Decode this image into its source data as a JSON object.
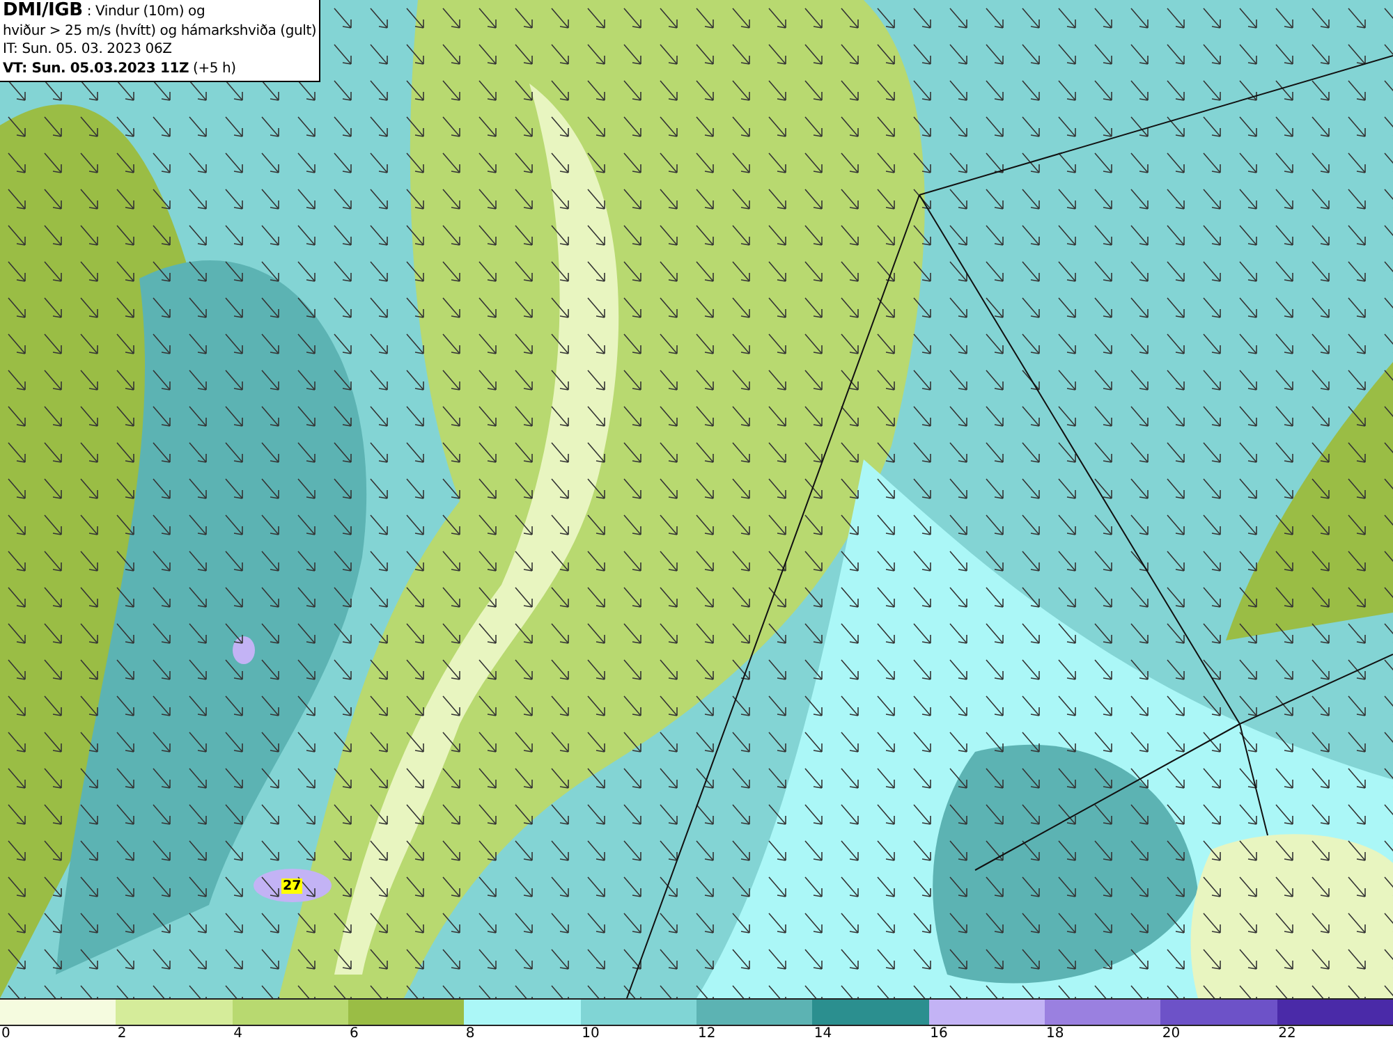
{
  "info_box": {
    "lines": [
      "**DMI/IGB** : Vindur (10m) og",
      "hviður > 25 m/s (hvítt) og hámarkshviða (gult)",
      "IT: Sun. 05. 03. 2023 06Z",
      "**VT: Sun. 05.03.2023 11Z** (+5 h)"
    ]
  },
  "map": {
    "gust_label": "27"
  },
  "legend": [
    {
      "label": "0",
      "color": "#f5fbdf"
    },
    {
      "label": "2",
      "color": "#d5ec9a"
    },
    {
      "label": "4",
      "color": "#b8d970"
    },
    {
      "label": "6",
      "color": "#9abd45"
    },
    {
      "label": "8",
      "color": "#abf7f7"
    },
    {
      "label": "10",
      "color": "#80d5d5"
    },
    {
      "label": "12",
      "color": "#5cb3b3"
    },
    {
      "label": "14",
      "color": "#2b8f8f"
    },
    {
      "label": "16",
      "color": "#c3b3f5"
    },
    {
      "label": "18",
      "color": "#9a80e0"
    },
    {
      "label": "20",
      "color": "#6d52c8"
    },
    {
      "label": "22",
      "color": "#4a2aa8"
    }
  ]
}
